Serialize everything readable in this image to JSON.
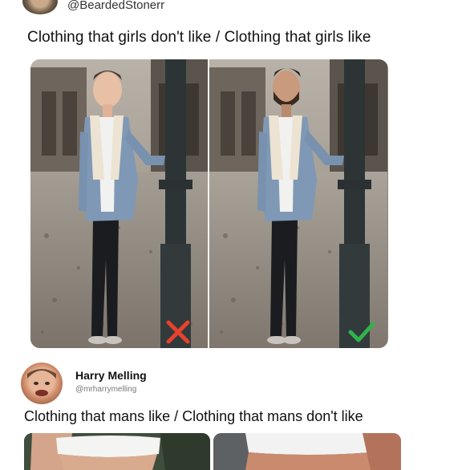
{
  "top_tweet": {
    "handle": "@BeardedStonerr",
    "caption": "Clothing that girls don't like  /  Clothing that girls like"
  },
  "comparison_image": {
    "left_mark": "cross-icon",
    "right_mark": "check-icon",
    "left_mark_color": "#e8412c",
    "right_mark_color": "#2fb34a"
  },
  "reply_tweet": {
    "name": "Harry Melling",
    "handle": "@mrharrymelling",
    "caption": "Clothing that mans like  /  Clothing that mans don't like"
  }
}
